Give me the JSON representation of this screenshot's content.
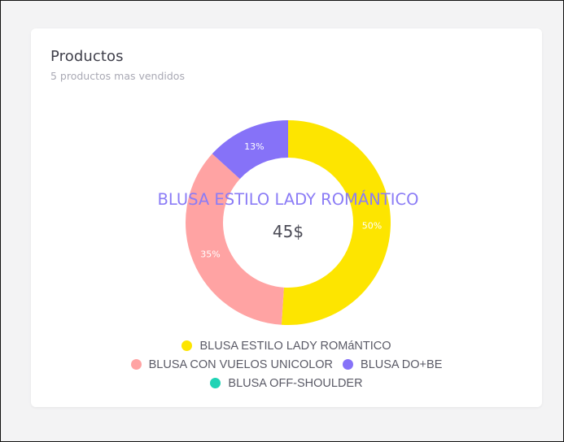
{
  "card": {
    "title": "Productos",
    "subtitle": "5 productos mas vendidos"
  },
  "chart_data": {
    "type": "donut",
    "center": {
      "label": "BLUSA ESTILO LADY ROMÁNTICO",
      "value": "45$",
      "label_color": "#8b7cf6"
    },
    "slices": [
      {
        "name": "BLUSA ESTILO LADY ROMáNTICO",
        "percent": 50,
        "label": "50%",
        "color": "#fde500"
      },
      {
        "name": "BLUSA CON VUELOS UNICOLOR",
        "percent": 35,
        "label": "35%",
        "color": "#ffa3a3"
      },
      {
        "name": "BLUSA DO+BE",
        "percent": 13,
        "label": "13%",
        "color": "#8672f8"
      },
      {
        "name": "BLUSA OFF-SHOULDER",
        "percent": 0,
        "label": "",
        "color": "#1fd3b5"
      }
    ]
  },
  "legend": {
    "rows": [
      [
        0
      ],
      [
        1,
        2
      ],
      [
        3
      ]
    ]
  }
}
